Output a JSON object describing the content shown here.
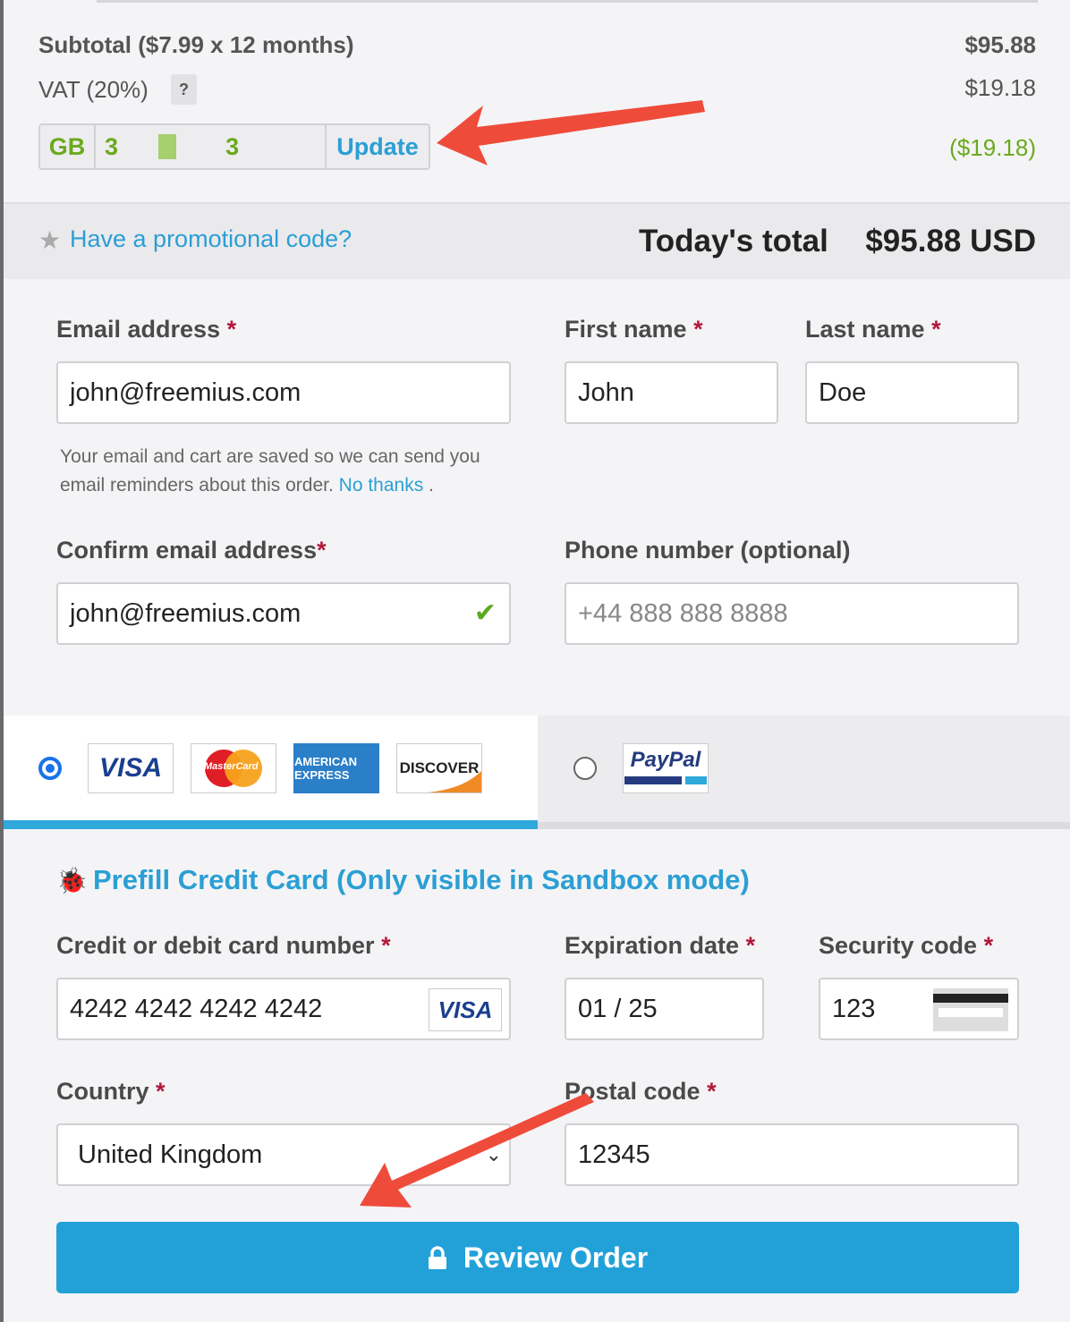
{
  "summary": {
    "subtotal_label": "Subtotal ($7.99 x 12 months)",
    "subtotal_value": "$95.88",
    "vat_label": "VAT (20%)",
    "vat_help": "?",
    "vat_value": "$19.18",
    "vat_country": "GB",
    "vat_number": "3        3",
    "vat_update": "Update",
    "vat_credit": "($19.18)"
  },
  "promo": {
    "link": "Have a promotional code?",
    "total_label": "Today's total",
    "total_value": "$95.88 USD"
  },
  "form": {
    "email_label": "Email address",
    "email_value": "john@freemius.com",
    "first_label": "First name",
    "first_value": "John",
    "last_label": "Last name",
    "last_value": "Doe",
    "hint": "Your email and cart are saved so we can send you email reminders about this order.",
    "no_thanks": "No thanks",
    "confirm_label": "Confirm email address",
    "confirm_value": "john@freemius.com",
    "phone_label": "Phone number (optional)",
    "phone_placeholder": "+44 888 888 8888",
    "req": "*"
  },
  "payment": {
    "method": "card",
    "cards": [
      "VISA",
      "MasterCard",
      "AMERICAN EXPRESS",
      "DISCOVER"
    ],
    "paypal": "PayPal"
  },
  "card": {
    "prefill": "Prefill Credit Card (Only visible in Sandbox mode)",
    "number_label": "Credit or debit card number",
    "number_value": "4242 4242 4242 4242",
    "brand": "VISA",
    "exp_label": "Expiration date",
    "exp_value": "01 / 25",
    "cvc_label": "Security code",
    "cvc_value": "123",
    "country_label": "Country",
    "country_value": "United Kingdom",
    "postal_label": "Postal code",
    "postal_value": "12345"
  },
  "review_button": "Review Order",
  "colors": {
    "accent": "#22a1d9",
    "green": "#6aaa1e",
    "required": "#b0183a",
    "arrow": "#ef4b3b"
  }
}
